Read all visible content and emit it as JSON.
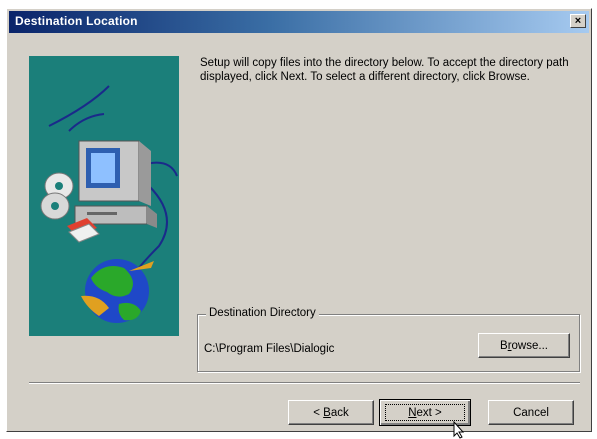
{
  "window": {
    "title": "Destination Location",
    "close_glyph": "×"
  },
  "intro_text": "Setup will copy files into the directory below. To accept the directory path displayed, click Next. To select a different directory, click Browse.",
  "destination": {
    "group_label": "Destination Directory",
    "path": "C:\\Program Files\\Dialogic",
    "browse": {
      "pre": "B",
      "key": "r",
      "post": "owse..."
    }
  },
  "buttons": {
    "back": {
      "pre": "< ",
      "key": "B",
      "post": "ack"
    },
    "next": {
      "pre": "",
      "key": "N",
      "post": "ext >"
    },
    "cancel": "Cancel"
  },
  "colors": {
    "title_start": "#0a246a",
    "title_end": "#a6caf0",
    "artwork_bg": "#1b7f7a",
    "face": "#d4d0c8"
  },
  "icons": [
    "computer-icon",
    "cd-icon",
    "floppy-icon",
    "globe-icon",
    "close-icon",
    "cursor-icon"
  ]
}
